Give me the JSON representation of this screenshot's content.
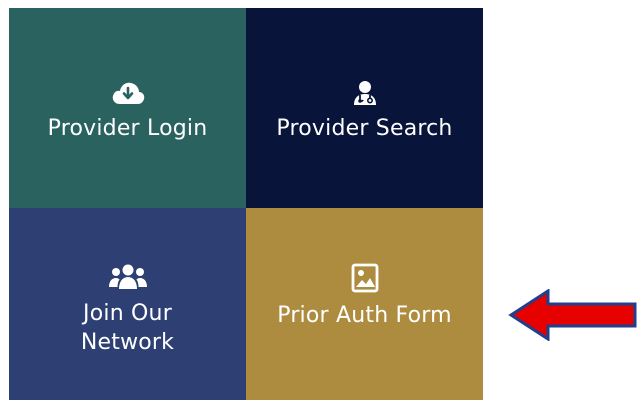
{
  "tiles": [
    {
      "label": "Provider Login",
      "icon": "cloud-download-icon",
      "color": "#2a625f"
    },
    {
      "label": "Provider Search",
      "icon": "doctor-icon",
      "color": "#08143a"
    },
    {
      "label": "Join Our\nNetwork",
      "icon": "users-group-icon",
      "color": "#2e4073"
    },
    {
      "label": "Prior Auth Form",
      "icon": "image-file-icon",
      "color": "#ad8c3f"
    }
  ],
  "arrow": {
    "icon": "left-arrow-icon",
    "fill": "#e60000",
    "stroke": "#1f3f8f"
  }
}
